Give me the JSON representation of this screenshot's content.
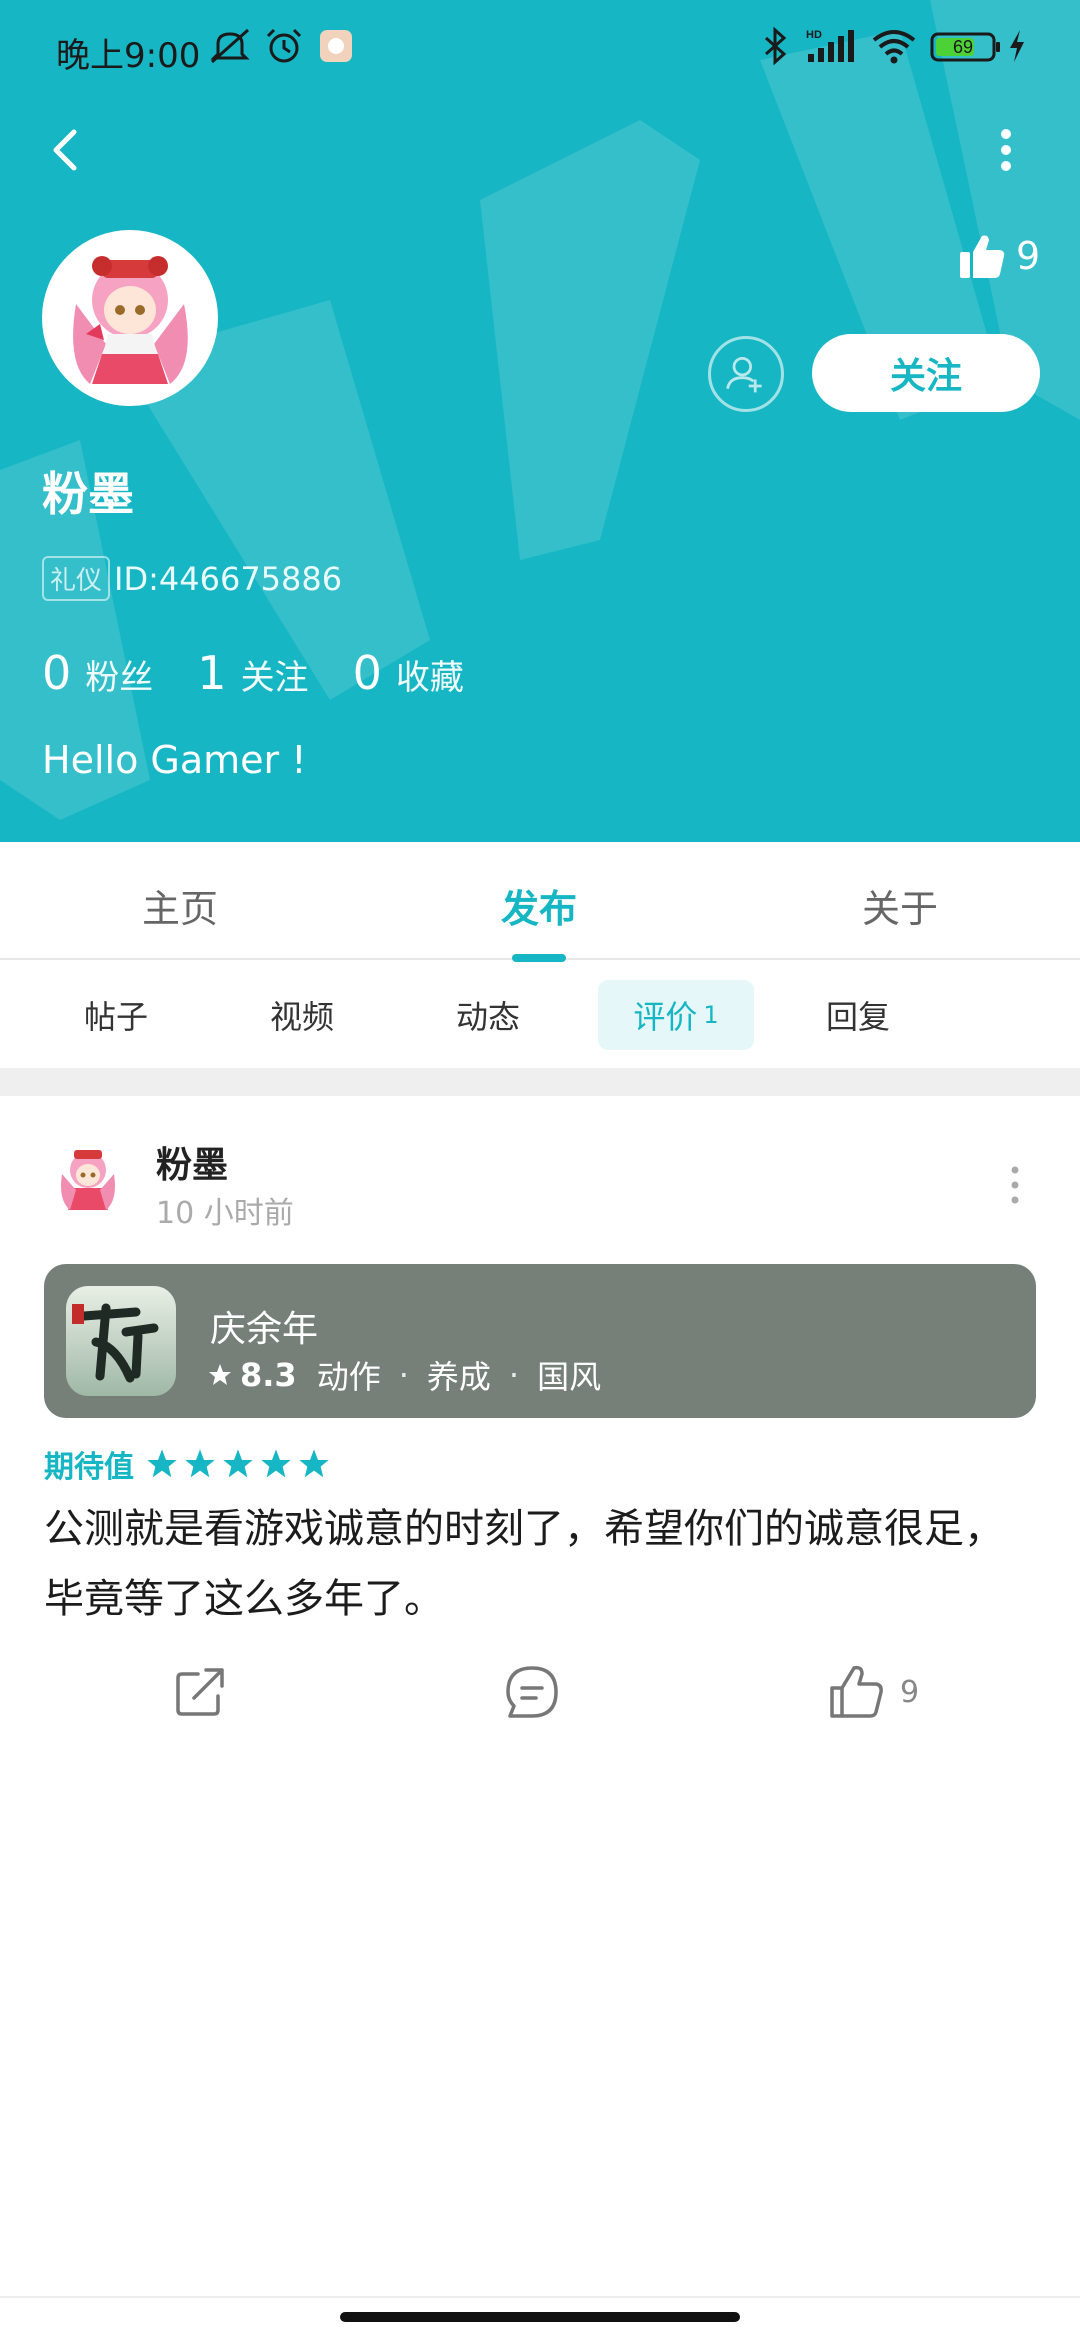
{
  "status_bar": {
    "time": "晚上9:00",
    "battery": "69"
  },
  "header": {
    "like_count": "9",
    "follow_label": "关注",
    "username": "粉墨",
    "badge": "礼仪",
    "id_text": "ID:446675886",
    "stats": [
      {
        "num": "0",
        "label": "粉丝"
      },
      {
        "num": "1",
        "label": "关注"
      },
      {
        "num": "0",
        "label": "收藏"
      }
    ],
    "bio": "Hello Gamer !"
  },
  "main_tabs": [
    "主页",
    "发布",
    "关于"
  ],
  "sub_tabs": [
    {
      "label": "帖子"
    },
    {
      "label": "视频"
    },
    {
      "label": "动态"
    },
    {
      "label": "评价",
      "count": "1"
    },
    {
      "label": "回复"
    }
  ],
  "review": {
    "author": "粉墨",
    "time": "10 小时前",
    "game": {
      "name": "庆余年",
      "rating": "8.3",
      "tags": [
        "动作",
        "养成",
        "国风"
      ]
    },
    "expect_label": "期待值",
    "stars": 5,
    "text": "公测就是看游戏诚意的时刻了，希望你们的诚意很足，毕竟等了这么多年了。",
    "like_count": "9"
  },
  "colors": {
    "accent": "#16b6c4",
    "game_card": "#768079"
  },
  "icons": [
    "back-icon",
    "more-icon",
    "thumb-up-icon",
    "add-friend-icon",
    "share-icon",
    "comment-icon",
    "star-icon"
  ]
}
